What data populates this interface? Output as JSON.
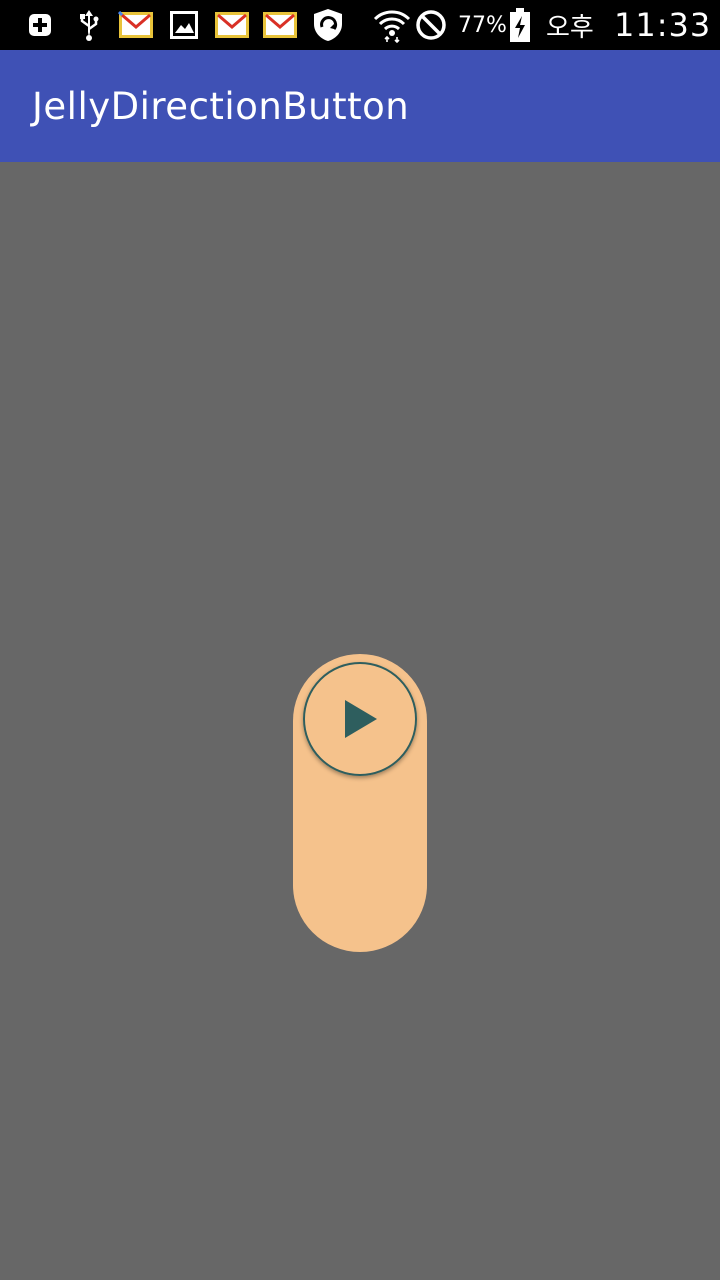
{
  "status_bar": {
    "battery_text": "77%",
    "ampm": "오후",
    "time": "11:33",
    "icons": [
      "add-box-icon",
      "usb-icon",
      "gmail-icon",
      "gallery-icon",
      "gmail-icon",
      "gmail-icon",
      "vpn-shield-icon",
      "wifi-icon",
      "do-not-disturb-icon",
      "battery-charging-icon"
    ]
  },
  "app_bar": {
    "title": "JellyDirectionButton",
    "color": "#3F51B5"
  },
  "jelly_button": {
    "track_color": "#F5C28C",
    "icon": "play-icon",
    "icon_color": "#2E5E5E",
    "background_color": "#676767"
  }
}
